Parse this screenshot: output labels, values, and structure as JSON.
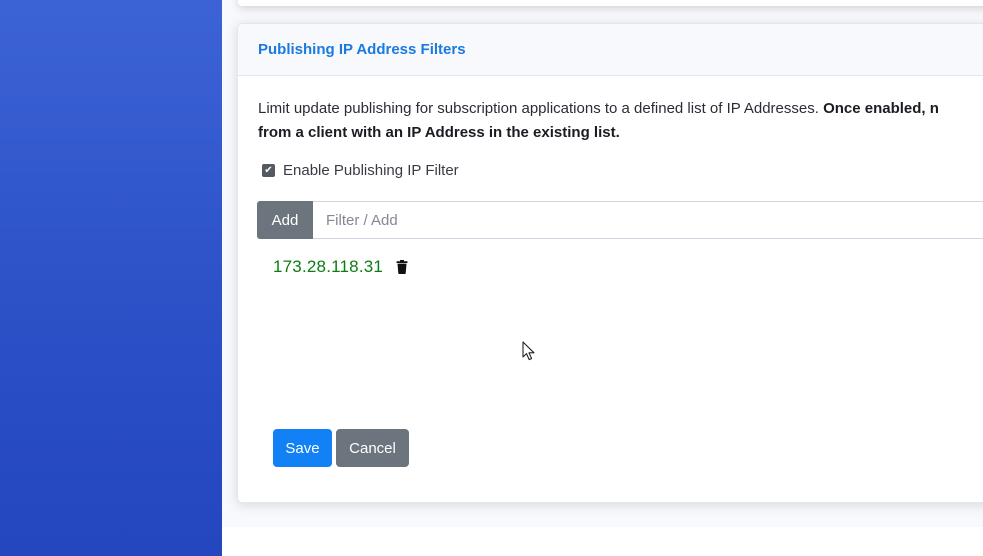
{
  "card": {
    "title": "Publishing IP Address Filters",
    "description": "Limit update publishing for subscription applications to a defined list of IP Addresses. ",
    "description_bold": "Once enabled, n",
    "description_bold_line2": "from a client with an IP Address in the existing list."
  },
  "filter": {
    "enable_label": "Enable Publishing IP Filter",
    "enabled": true,
    "add_label": "Add",
    "input_placeholder": "Filter / Add",
    "ip_addresses": [
      "173.28.118.31"
    ]
  },
  "actions": {
    "save_label": "Save",
    "cancel_label": "Cancel"
  },
  "colors": {
    "accent": "#1a7ae0",
    "save_button": "#1181f5",
    "secondary_button": "#6c757d",
    "ip_text": "#0b7d12",
    "sidebar": "#2a4fc6"
  },
  "icons": {
    "checkbox": "check-icon",
    "delete": "trash-icon",
    "cursor": "mouse-pointer-icon"
  }
}
